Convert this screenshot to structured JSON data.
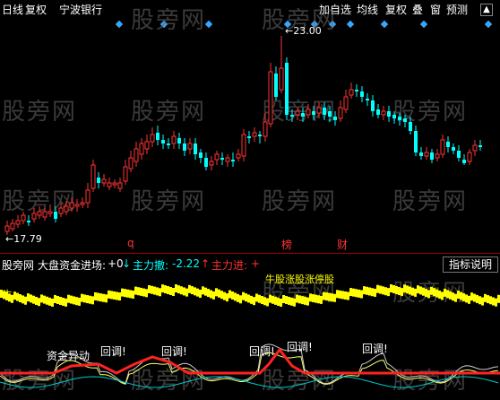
{
  "toolbar": {
    "daily": "日线",
    "adjust": "复权",
    "stock_name": "宁波银行",
    "add_favorite": "加自选",
    "ma": "均线",
    "adjust2": "复权",
    "overlay": "叠",
    "window": "窗",
    "forecast": "预测"
  },
  "watermark": "股旁网",
  "price_chart": {
    "high_label": "23.00",
    "low_label": "17.79",
    "markers": [
      "q",
      "榜",
      "财"
    ],
    "colors": {
      "up": "#ff3333",
      "down": "#00ffff",
      "marker_red": "#ff3333",
      "diamond": "#36a6ff"
    }
  },
  "indicator_header": {
    "site": "股旁网",
    "indicator_name": "大盘资金进场:",
    "value": "+0",
    "down_arrow": "↓",
    "main_withdraw_label": "主力撤:",
    "main_withdraw_value": "-2.22",
    "up_arrow": "↑",
    "main_enter_label": "主力进:",
    "main_enter_value": "+",
    "help_button": "指标说明"
  },
  "band_labels": {
    "bull": "牛",
    "line_text": "牛股涨股涨停股"
  },
  "lower_panel": {
    "fund_label": "资金异动",
    "pullback_labels": [
      "回调!",
      "回调!",
      "回调!",
      "回调!",
      "回调!"
    ]
  }
}
